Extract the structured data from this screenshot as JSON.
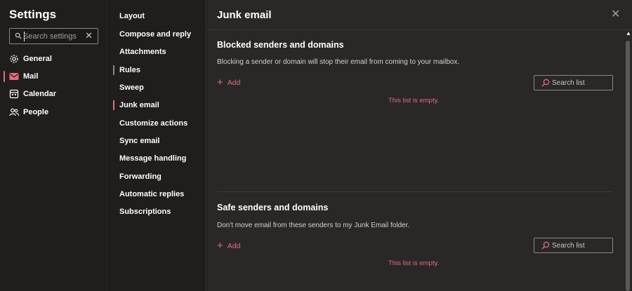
{
  "left_nav": {
    "title": "Settings",
    "search_placeholder": "Search settings",
    "search_clear": "✕",
    "categories": [
      {
        "label": "General",
        "icon": "gear-icon"
      },
      {
        "label": "Mail",
        "icon": "mail-icon"
      },
      {
        "label": "Calendar",
        "icon": "calendar-icon"
      },
      {
        "label": "People",
        "icon": "people-icon"
      }
    ]
  },
  "sub_nav": {
    "items": [
      {
        "label": "Layout"
      },
      {
        "label": "Compose and reply"
      },
      {
        "label": "Attachments"
      },
      {
        "label": "Rules"
      },
      {
        "label": "Sweep"
      },
      {
        "label": "Junk email"
      },
      {
        "label": "Customize actions"
      },
      {
        "label": "Sync email"
      },
      {
        "label": "Message handling"
      },
      {
        "label": "Forwarding"
      },
      {
        "label": "Automatic replies"
      },
      {
        "label": "Subscriptions"
      }
    ]
  },
  "panel": {
    "title": "Junk email",
    "close": "✕",
    "sections": [
      {
        "title": "Blocked senders and domains",
        "description": "Blocking a sender or domain will stop their email from coming to your mailbox.",
        "add_label": "Add",
        "search_placeholder": "Search list",
        "empty_text": "This list is empty."
      },
      {
        "title": "Safe senders and domains",
        "description": "Don't move email from these senders to my Junk Email folder.",
        "add_label": "Add",
        "search_placeholder": "Search list",
        "empty_text": "This list is empty."
      }
    ]
  },
  "colors": {
    "accent": "#e36d7a",
    "background": "#1f1e1d",
    "panel_background": "#292827"
  }
}
